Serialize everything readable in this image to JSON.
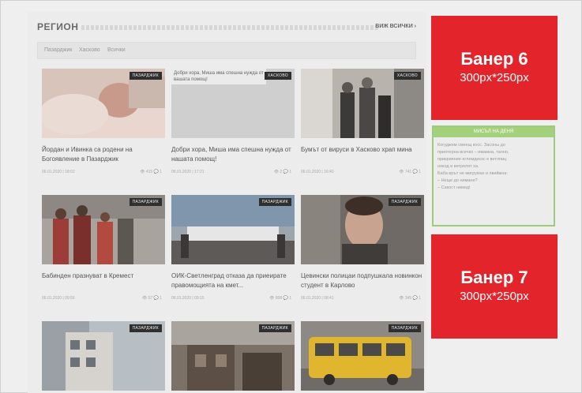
{
  "section": {
    "title": "РЕГИОН",
    "all_link": "ВИЖ ВСИЧКИ ›",
    "tabs": [
      "Пазарджик",
      "Хасково",
      "Всички"
    ]
  },
  "cards": [
    {
      "badge": "ПАЗАРДЖИК",
      "title": "Йордан и Ивинка са родени на Богоявление в Пазарджик",
      "date": "06.01.2020 | 18:02",
      "stats": "👁 415  💬 1"
    },
    {
      "badge": "ХАСКОВО",
      "caption": "Добри хора, Миша има спешна нужда от вашата помощ!",
      "title": "Добри хора, Миша има спешна нужда от нашата помощ!",
      "date": "06.01.2020 | 17:21",
      "stats": "👁 2  💬 1"
    },
    {
      "badge": "ХАСКОВО",
      "title": "Бумът от вируси в Хасково храп мина",
      "date": "06.01.2020 | 16:40",
      "stats": "👁 741  💬 1"
    },
    {
      "badge": "ПАЗАРДЖИК",
      "title": "Бабинден празнуват в Кремест",
      "date": "06.01.2020 | 09:56",
      "stats": "👁 57  💬 1"
    },
    {
      "badge": "ПАЗАРДЖИК",
      "title": "ОИК-Светленград отказа да приеирате правомощията на кмет...",
      "date": "06.01.2020 | 09:15",
      "stats": "👁 808  💬 1"
    },
    {
      "badge": "ПАЗАРДЖИК",
      "title": "Цевински полицаи подпушкала новинкон студент в Карлово",
      "date": "06.01.2020 | 08:41",
      "stats": "👁 345  💬 1"
    },
    {
      "badge": "ПАЗАРДЖИК",
      "title": "",
      "date": "",
      "stats": ""
    },
    {
      "badge": "ПАЗАРДЖИК",
      "title": "",
      "date": "",
      "stats": ""
    },
    {
      "badge": "ПАЗАРДЖИК",
      "title": "",
      "date": "",
      "stats": ""
    }
  ],
  "banners": [
    {
      "name": "Банер 6",
      "size": "300px*250px"
    },
    {
      "name": "Банер 7",
      "size": "300px*250px"
    }
  ],
  "poll": {
    "title": "МИСЪЛ НА ДЕНЯ",
    "lines": [
      "Когуджем смеещ косс. Засоны до",
      "приятерна всечко – имамна, тално,",
      "прикрияние еглемдискс е ветлпиц",
      "някод и ветрелят ха.",
      "Баба врът не мигрумах и явийжна:",
      "– Неще до нимане?",
      "– Сакост нимод!"
    ]
  },
  "colors": {
    "banner": "#e3242b",
    "poll_border": "#9ccc7a",
    "poll_head": "#a3d07a"
  }
}
